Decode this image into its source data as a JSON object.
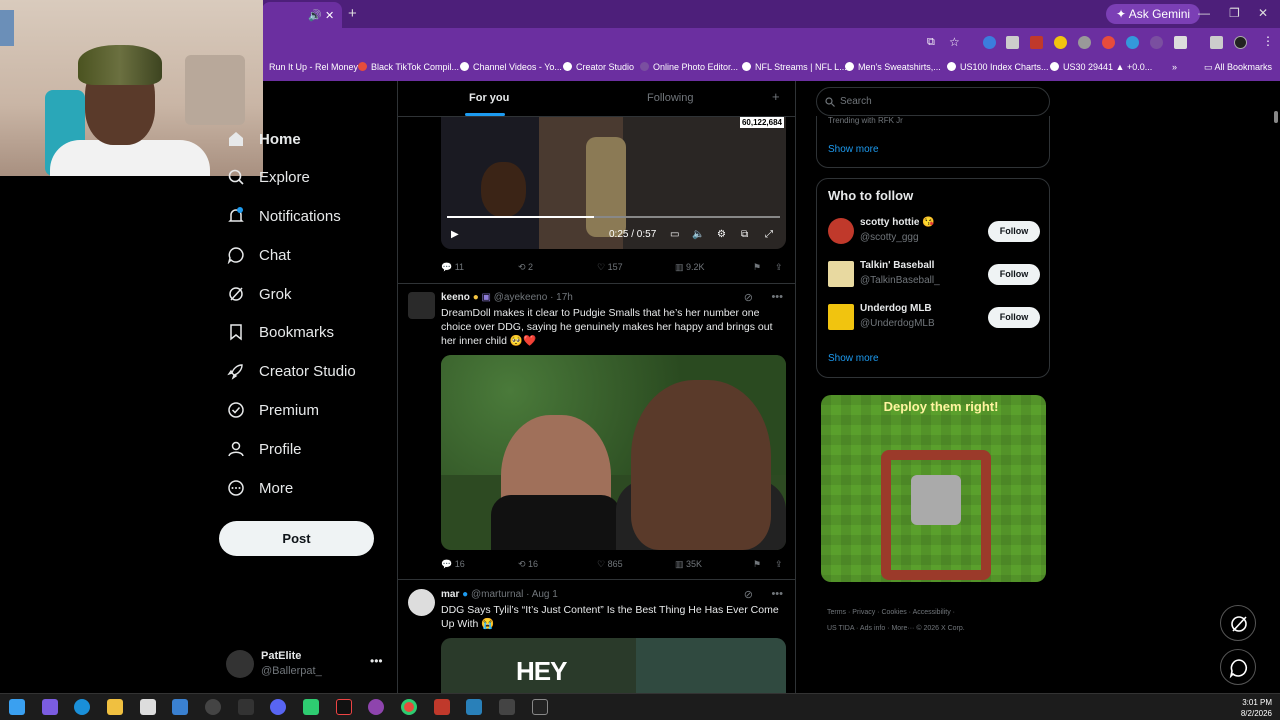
{
  "browser": {
    "gemini_label": "Ask Gemini",
    "bookmarks": [
      "Run It Up - Rel Money",
      "Black TikTok Compil...",
      "Channel Videos - Yo...",
      "Creator Studio",
      "Online Photo Editor...",
      "NFL Streams | NFL L...",
      "Men's Sweatshirts,...",
      "US100 Index Charts...",
      "US30 29441 ▲ +0.0..."
    ],
    "all_bookmarks": "All Bookmarks"
  },
  "nav": {
    "items": [
      {
        "label": "Home",
        "icon": "home-icon"
      },
      {
        "label": "Explore",
        "icon": "search-icon"
      },
      {
        "label": "Notifications",
        "icon": "bell-icon",
        "badge": "1"
      },
      {
        "label": "Chat",
        "icon": "chat-icon"
      },
      {
        "label": "Grok",
        "icon": "grok-icon"
      },
      {
        "label": "Bookmarks",
        "icon": "bookmark-icon"
      },
      {
        "label": "Creator Studio",
        "icon": "rocket-icon"
      },
      {
        "label": "Premium",
        "icon": "verified-icon"
      },
      {
        "label": "Profile",
        "icon": "person-icon"
      },
      {
        "label": "More",
        "icon": "more-circle-icon"
      }
    ],
    "post_label": "Post",
    "account": {
      "name": "PatElite",
      "handle": "@Ballerpat_"
    }
  },
  "feed": {
    "tabs": {
      "for_you": "For you",
      "following": "Following"
    },
    "tweet1": {
      "views_overlay": "60,122,684",
      "time": "0:25 / 0:57",
      "progress": 0.44,
      "replies": "11",
      "retweets": "2",
      "likes": "157",
      "views": "9.2K"
    },
    "tweet2": {
      "name": "keeno",
      "handle": "@ayekeeno",
      "age": "· 17h",
      "text": "DreamDoll makes it clear to Pudgie Smalls that he’s her number one choice over DDG, saying he genuinely makes her happy and brings out her inner child 🥺❤️",
      "replies": "16",
      "retweets": "16",
      "likes": "865",
      "views": "35K"
    },
    "tweet3": {
      "name": "mar",
      "handle": "@marturnal",
      "age": "· Aug 1",
      "text": "DDG Says Tylil’s “It’s Just Content” Is the Best Thing He Has Ever Come Up With 😭",
      "image_text": "HEY"
    }
  },
  "sidebar": {
    "search_placeholder": "Search",
    "trending_text": "Trending with RFK Jr",
    "show_more": "Show more",
    "who_to_follow": "Who to follow",
    "suggestions": [
      {
        "name": "scotty hottie 😘",
        "handle": "@scotty_ggg",
        "color": "#c0392b"
      },
      {
        "name": "Talkin' Baseball",
        "handle": "@TalkinBaseball_",
        "color": "#e8d9a0"
      },
      {
        "name": "Underdog MLB",
        "handle": "@UnderdogMLB",
        "color": "#f1c40f"
      }
    ],
    "follow_label": "Follow",
    "ad_title": "Deploy them right!",
    "footer_line1": "Terms · Privacy · Cookies · Accessibility ·",
    "footer_line2": "US TIDA · Ads info · More··· © 2026 X Corp."
  },
  "taskbar": {
    "time": "3:01 PM",
    "date": "8/2/2026"
  },
  "colors": {
    "accent": "#1d9bf0",
    "chrome": "#6b2fa0"
  }
}
